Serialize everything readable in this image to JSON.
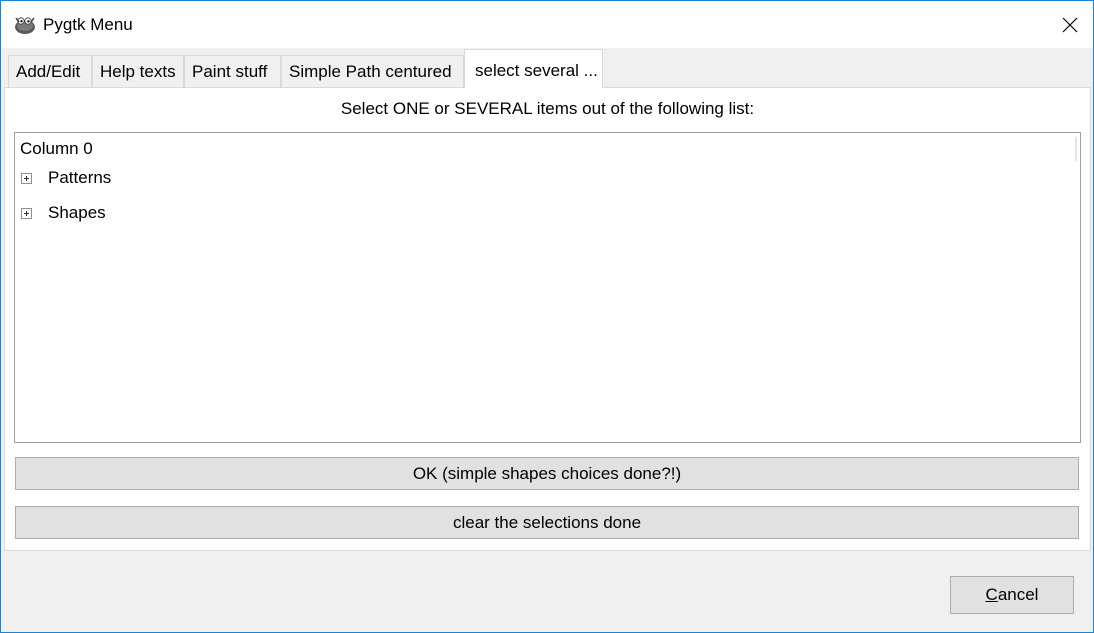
{
  "window": {
    "title": "Pygtk Menu",
    "icon": "gimp-wilber-icon",
    "close_icon": "close-icon"
  },
  "tabs": [
    {
      "label": "Add/Edit",
      "active": false
    },
    {
      "label": "Help texts",
      "active": false
    },
    {
      "label": "Paint stuff",
      "active": false
    },
    {
      "label": "Simple Path centured",
      "active": false
    },
    {
      "label": "select several ...",
      "active": true
    }
  ],
  "panel": {
    "instructions": "Select ONE or SEVERAL items out of the following list:",
    "tree": {
      "column_header": "Column 0",
      "rows": [
        {
          "label": "Patterns",
          "expander": "plus-expander-icon"
        },
        {
          "label": "Shapes",
          "expander": "plus-expander-icon"
        }
      ]
    },
    "ok_button": "OK (simple shapes choices done?!)",
    "clear_button": "clear the selections done"
  },
  "footer": {
    "cancel_mnemonic": "C",
    "cancel_rest": "ancel"
  }
}
